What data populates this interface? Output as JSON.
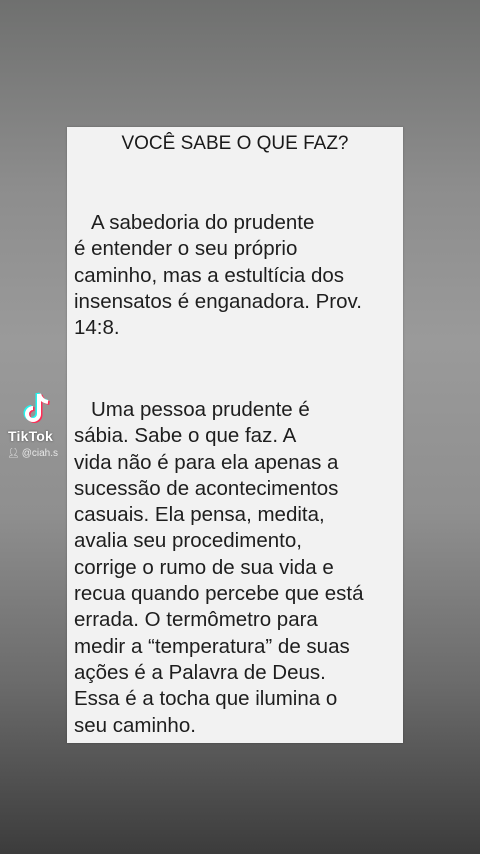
{
  "card": {
    "title": "VOCÊ SABE O QUE FAZ?",
    "paragraph1": [
      "A sabedoria do prudente",
      "é entender o seu próprio",
      "caminho, mas a estultícia dos",
      "insensatos é enganadora. Prov.",
      "14:8."
    ],
    "paragraph2": [
      "Uma pessoa prudente é",
      "sábia. Sabe o que faz. A",
      "vida não é para ela apenas a",
      "sucessão de acontecimentos",
      "casuais. Ela pensa, medita,",
      "avalia seu procedimento,",
      "corrige o rumo de sua vida e",
      "recua quando percebe que está",
      "errada. O termômetro para",
      "medir a “temperatura” de suas",
      "ações é a Palavra de Deus.",
      "Essa é a tocha que ilumina o",
      "seu caminho."
    ]
  },
  "watermark": {
    "brand": "TikTok",
    "username": "@ciah.s",
    "logo_icon": "tiktok-note-icon",
    "user_icon": "person-icon"
  },
  "colors": {
    "card_background": "#f2f2f2",
    "text": "#1e1e1e",
    "background_top": "#6f706f",
    "background_bottom": "#3c3c3c"
  }
}
